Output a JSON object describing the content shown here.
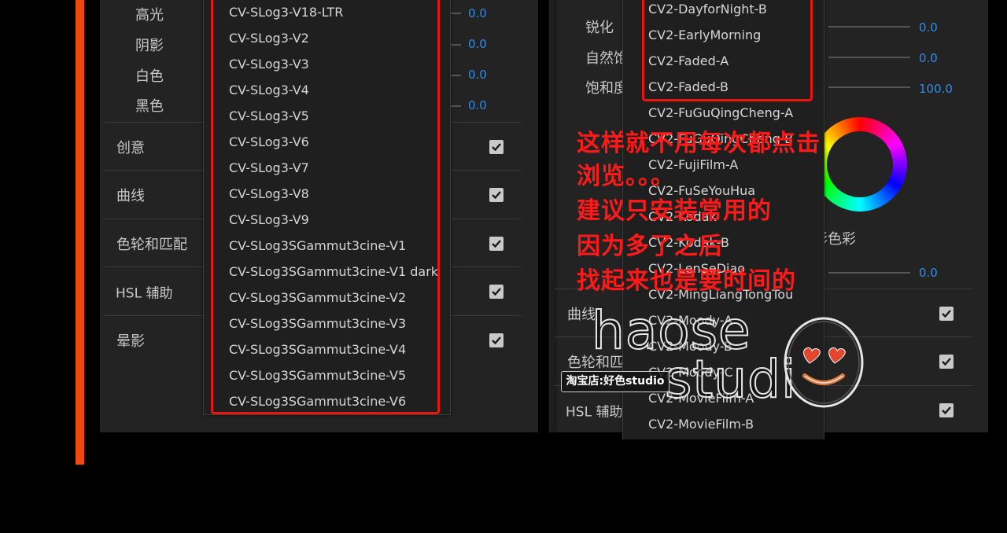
{
  "left_panel": {
    "sliders": [
      {
        "label": "高光",
        "value": "0.0"
      },
      {
        "label": "阴影",
        "value": "0.0"
      },
      {
        "label": "白色",
        "value": "0.0"
      },
      {
        "label": "黑色",
        "value": "0.0"
      }
    ],
    "sections": [
      {
        "label": "创意",
        "checked": true
      },
      {
        "label": "曲线",
        "checked": true
      },
      {
        "label": "色轮和匹配",
        "checked": true
      },
      {
        "label": "HSL 辅助",
        "checked": true
      },
      {
        "label": "晕影",
        "checked": true
      }
    ]
  },
  "left_dropdown": {
    "items": [
      "CV-SLog3-V18-LTR",
      "CV-SLog3-V2",
      "CV-SLog3-V3",
      "CV-SLog3-V4",
      "CV-SLog3-V5",
      "CV-SLog3-V6",
      "CV-SLog3-V7",
      "CV-SLog3-V8",
      "CV-SLog3-V9",
      "CV-SLog3SGammut3cine-V1",
      "CV-SLog3SGammut3cine-V1 dark",
      "CV-SLog3SGammut3cine-V2",
      "CV-SLog3SGammut3cine-V3",
      "CV-SLog3SGammut3cine-V4",
      "CV-SLog3SGammut3cine-V5",
      "CV-SLog3SGammut3cine-V6"
    ]
  },
  "right_panel": {
    "sliders": [
      {
        "label": "锐化",
        "value": "0.0"
      },
      {
        "label": "自然饱和度",
        "value": "0.0"
      },
      {
        "label": "饱和度",
        "value": "100.0"
      }
    ],
    "wheel_label": "阴影色彩",
    "wheel_value": "0.0",
    "sections": [
      {
        "label": "曲线",
        "checked": true
      },
      {
        "label": "色轮和匹配",
        "checked": true
      },
      {
        "label": "HSL 辅助",
        "checked": true
      }
    ]
  },
  "right_dropdown": {
    "items": [
      "CV2-DayforNight-B",
      "CV2-EarlyMorning",
      "CV2-Faded-A",
      "CV2-Faded-B",
      "CV2-FuGuQingCheng-A",
      "CV2-FuGuQingCheng-B",
      "CV2-FujiFilm-A",
      "CV2-FuSeYouHua",
      "CV2-Kodak",
      "CV2-Kodak-B",
      "CV2-LenSeDiao",
      "CV2-MingLiangTongTou",
      "CV2-Moody-A",
      "CV2-Moody-B",
      "CV2-Moody-C",
      "CV2-MovieFilm-A",
      "CV2-MovieFilm-B"
    ]
  },
  "annotation": {
    "lines": [
      "这样就不用每次都点击",
      "浏览。。。",
      "建议只安装常用的",
      "因为多了之后",
      "找起来也是要时间的"
    ],
    "color": "#ff1a1a"
  },
  "watermark": {
    "line1": "haose",
    "line2": "studi",
    "badge": "淘宝店:好色studio"
  },
  "colors": {
    "accent": "#f0490f",
    "value_blue": "#2d8ceb",
    "highlight_box": "#e8160c"
  }
}
